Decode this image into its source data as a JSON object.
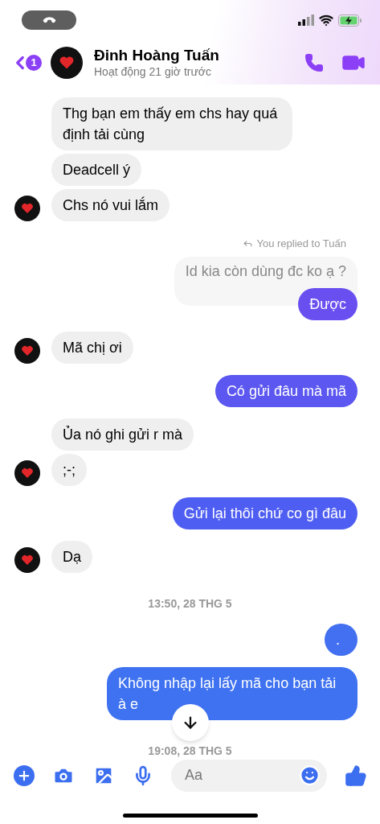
{
  "status_bar": {
    "call_active": true
  },
  "header": {
    "back_count": "1",
    "name": "Đinh Hoàng Tuấn",
    "status": "Hoạt động 21 giờ trước"
  },
  "messages": [
    {
      "kind": "incoming",
      "text": "Thg bạn em thấy em chs hay quá định tải cùng",
      "avatar": false
    },
    {
      "kind": "incoming",
      "text": "Deadcell ý",
      "avatar": false
    },
    {
      "kind": "incoming",
      "text": "Chs nó vui lắm",
      "avatar": true
    },
    {
      "kind": "reply",
      "label": "You replied to Tuấn",
      "quote": "Id kia còn dùng đc ko ạ ?",
      "text": "Được",
      "color": "#6a4ff0"
    },
    {
      "kind": "incoming",
      "text": "Mã chị ơi",
      "avatar": true
    },
    {
      "kind": "outgoing",
      "text": "Có gửi đâu mà mã",
      "color": "#5b57f0"
    },
    {
      "kind": "incoming",
      "text": "Ủa nó ghi gửi r mà",
      "avatar": false
    },
    {
      "kind": "incoming",
      "text": ";-;",
      "avatar": true
    },
    {
      "kind": "outgoing",
      "text": "Gửi lại thôi chứ co gì đâu",
      "color": "#4f5ef2"
    },
    {
      "kind": "incoming",
      "text": "Dạ",
      "avatar": true
    },
    {
      "kind": "timestamp",
      "text": "13:50, 28 THG 5"
    },
    {
      "kind": "outgoing",
      "text": ".",
      "color": "#4270f0"
    },
    {
      "kind": "outgoing",
      "text": "Không nhập lại lấy mã cho bạn tải à e",
      "color": "#3f72f0",
      "scroll_button": true
    },
    {
      "kind": "timestamp",
      "text": "19:08, 28 THG 5"
    }
  ],
  "composer": {
    "placeholder": "Aa"
  }
}
